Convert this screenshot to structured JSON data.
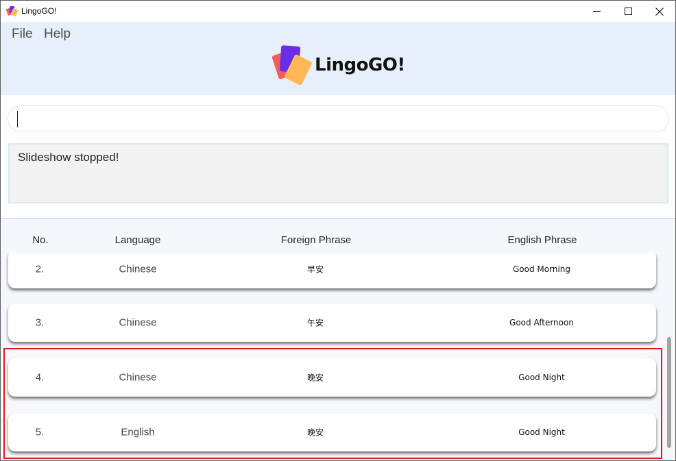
{
  "window": {
    "title": "LingoGO!"
  },
  "menu": {
    "file": "File",
    "help": "Help"
  },
  "logo": {
    "text": "LingoGO!"
  },
  "command": {
    "value": "",
    "placeholder": ""
  },
  "result": {
    "text": "Slideshow stopped!"
  },
  "list": {
    "headers": {
      "no": "No.",
      "language": "Language",
      "foreign": "Foreign Phrase",
      "english": "English Phrase"
    },
    "rows": [
      {
        "no": "2.",
        "language": "Chinese",
        "foreign": "早安",
        "english": "Good Morning"
      },
      {
        "no": "3.",
        "language": "Chinese",
        "foreign": "午安",
        "english": "Good Afternoon"
      },
      {
        "no": "4.",
        "language": "Chinese",
        "foreign": "晚安",
        "english": "Good Night"
      },
      {
        "no": "5.",
        "language": "English",
        "foreign": "晚安",
        "english": "Good Night"
      }
    ]
  },
  "colors": {
    "header_bg": "#e7f0fa",
    "highlight": "#e01b1b",
    "logo_purple": "#6a2ee8",
    "logo_red": "#f25c5c",
    "logo_orange": "#ffb859"
  }
}
